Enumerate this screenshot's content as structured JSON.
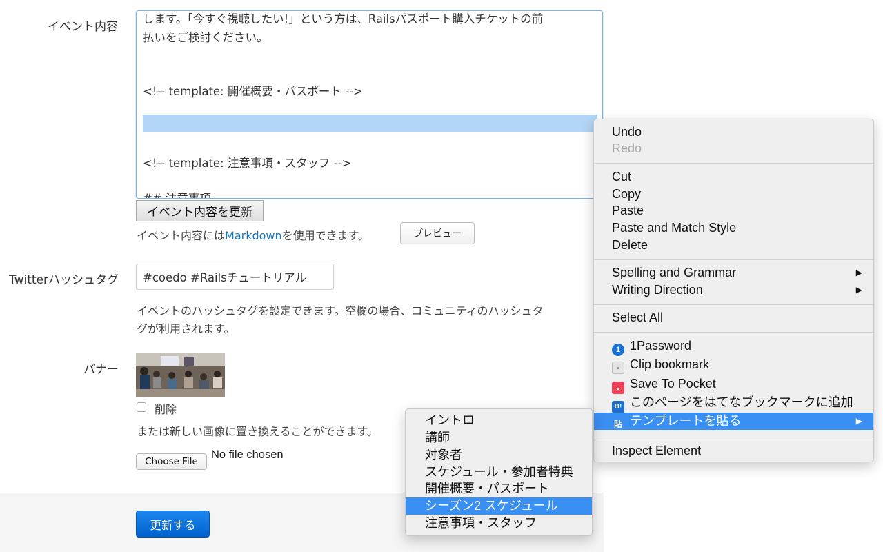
{
  "event_content": {
    "label": "イベント内容",
    "lines": [
      "します。「今すぐ視聴したい!」という方は、Railsパスポート購入チケットの前",
      "払いをご検討ください。",
      "<!-- template: 開催概要・パスポート -->",
      "<!-- template: 注意事項・スタッフ -->",
      "## 注意事項"
    ],
    "update_button": "イベント内容を更新",
    "help_prefix": "イベント内容には",
    "help_link": "Markdown",
    "help_suffix": "を使用できます。",
    "preview_button": "プレビュー"
  },
  "twitter": {
    "label": "Twitterハッシュタグ",
    "value": "#coedo #Railsチュートリアル",
    "help_line1": "イベントのハッシュタグを設定できます。空欄の場合、コミュニティのハッシュタ",
    "help_line2": "グが利用されます。"
  },
  "banner": {
    "label": "バナー",
    "delete_label": "削除",
    "replace_text": "または新しい画像に置き換えることができます。",
    "choose_file": "Choose File",
    "no_file": "No file chosen"
  },
  "footer": {
    "submit": "更新する"
  },
  "context_menu": {
    "undo": "Undo",
    "redo": "Redo",
    "cut": "Cut",
    "copy": "Copy",
    "paste": "Paste",
    "paste_match": "Paste and Match Style",
    "delete": "Delete",
    "spelling": "Spelling and Grammar",
    "writing": "Writing Direction",
    "select_all": "Select All",
    "onepassword": "1Password",
    "clip": "Clip bookmark",
    "pocket": "Save To Pocket",
    "hatena": "このページをはてなブックマークに追加",
    "template": "テンプレートを貼る",
    "inspect": "Inspect Element"
  },
  "template_submenu": [
    "イントロ",
    "講師",
    "対象者",
    "スケジュール・参加者特典",
    "開催概要・パスポート",
    "シーズン2 スケジュール",
    "注意事項・スタッフ"
  ],
  "colors": {
    "link": "#1478c8",
    "highlight": "#3a8ff2",
    "selection": "#b3d5f7",
    "primary_button": "#0062cc"
  }
}
